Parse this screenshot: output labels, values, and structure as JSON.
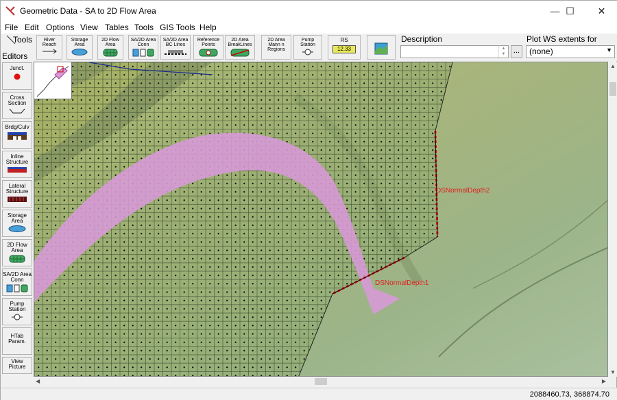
{
  "window": {
    "title": "Geometric Data - SA to 2D Flow Area"
  },
  "menu": [
    "File",
    "Edit",
    "Options",
    "View",
    "Tables",
    "Tools",
    "GIS Tools",
    "Help"
  ],
  "toolbar": {
    "tools_label": "Tools",
    "editors_label": "Editors",
    "buttons": [
      "River\nReach",
      "Storage\nArea",
      "2D Flow\nArea",
      "SA/2D Area\nConn",
      "SA/2D Area\nBC Lines",
      "Reference\nPoints",
      "2D Area\nBreakLines",
      "2D Area\nMann n\nRegions",
      "Pump\nStation",
      "RS"
    ],
    "rs_badge": "12.33",
    "description_label": "Description",
    "description_value": "",
    "description_dots": "...",
    "plot_label": "Plot WS extents for Profile:",
    "plot_value": "(none)"
  },
  "palette": [
    "Junct.",
    "Cross\nSection",
    "Brdg/Culv",
    "Inline\nStructure",
    "Lateral\nStructure",
    "Storage\nArea",
    "2D Flow\nArea",
    "SA/2D Area\nConn",
    "Pump\nStation",
    "HTab\nParam.",
    "View\nPicture"
  ],
  "map": {
    "labels": {
      "bc1": "DSNormalDepth1",
      "bc2": "DSNormalDepth2"
    },
    "colors": {
      "terrain_light": "#b7c27f",
      "mesh_green": "#8fa86a",
      "pink_region": "#d89ad8",
      "bc_line": "#e01010",
      "label_red": "#e02020"
    }
  },
  "status": {
    "coords": "2088460.73, 368874.70"
  }
}
